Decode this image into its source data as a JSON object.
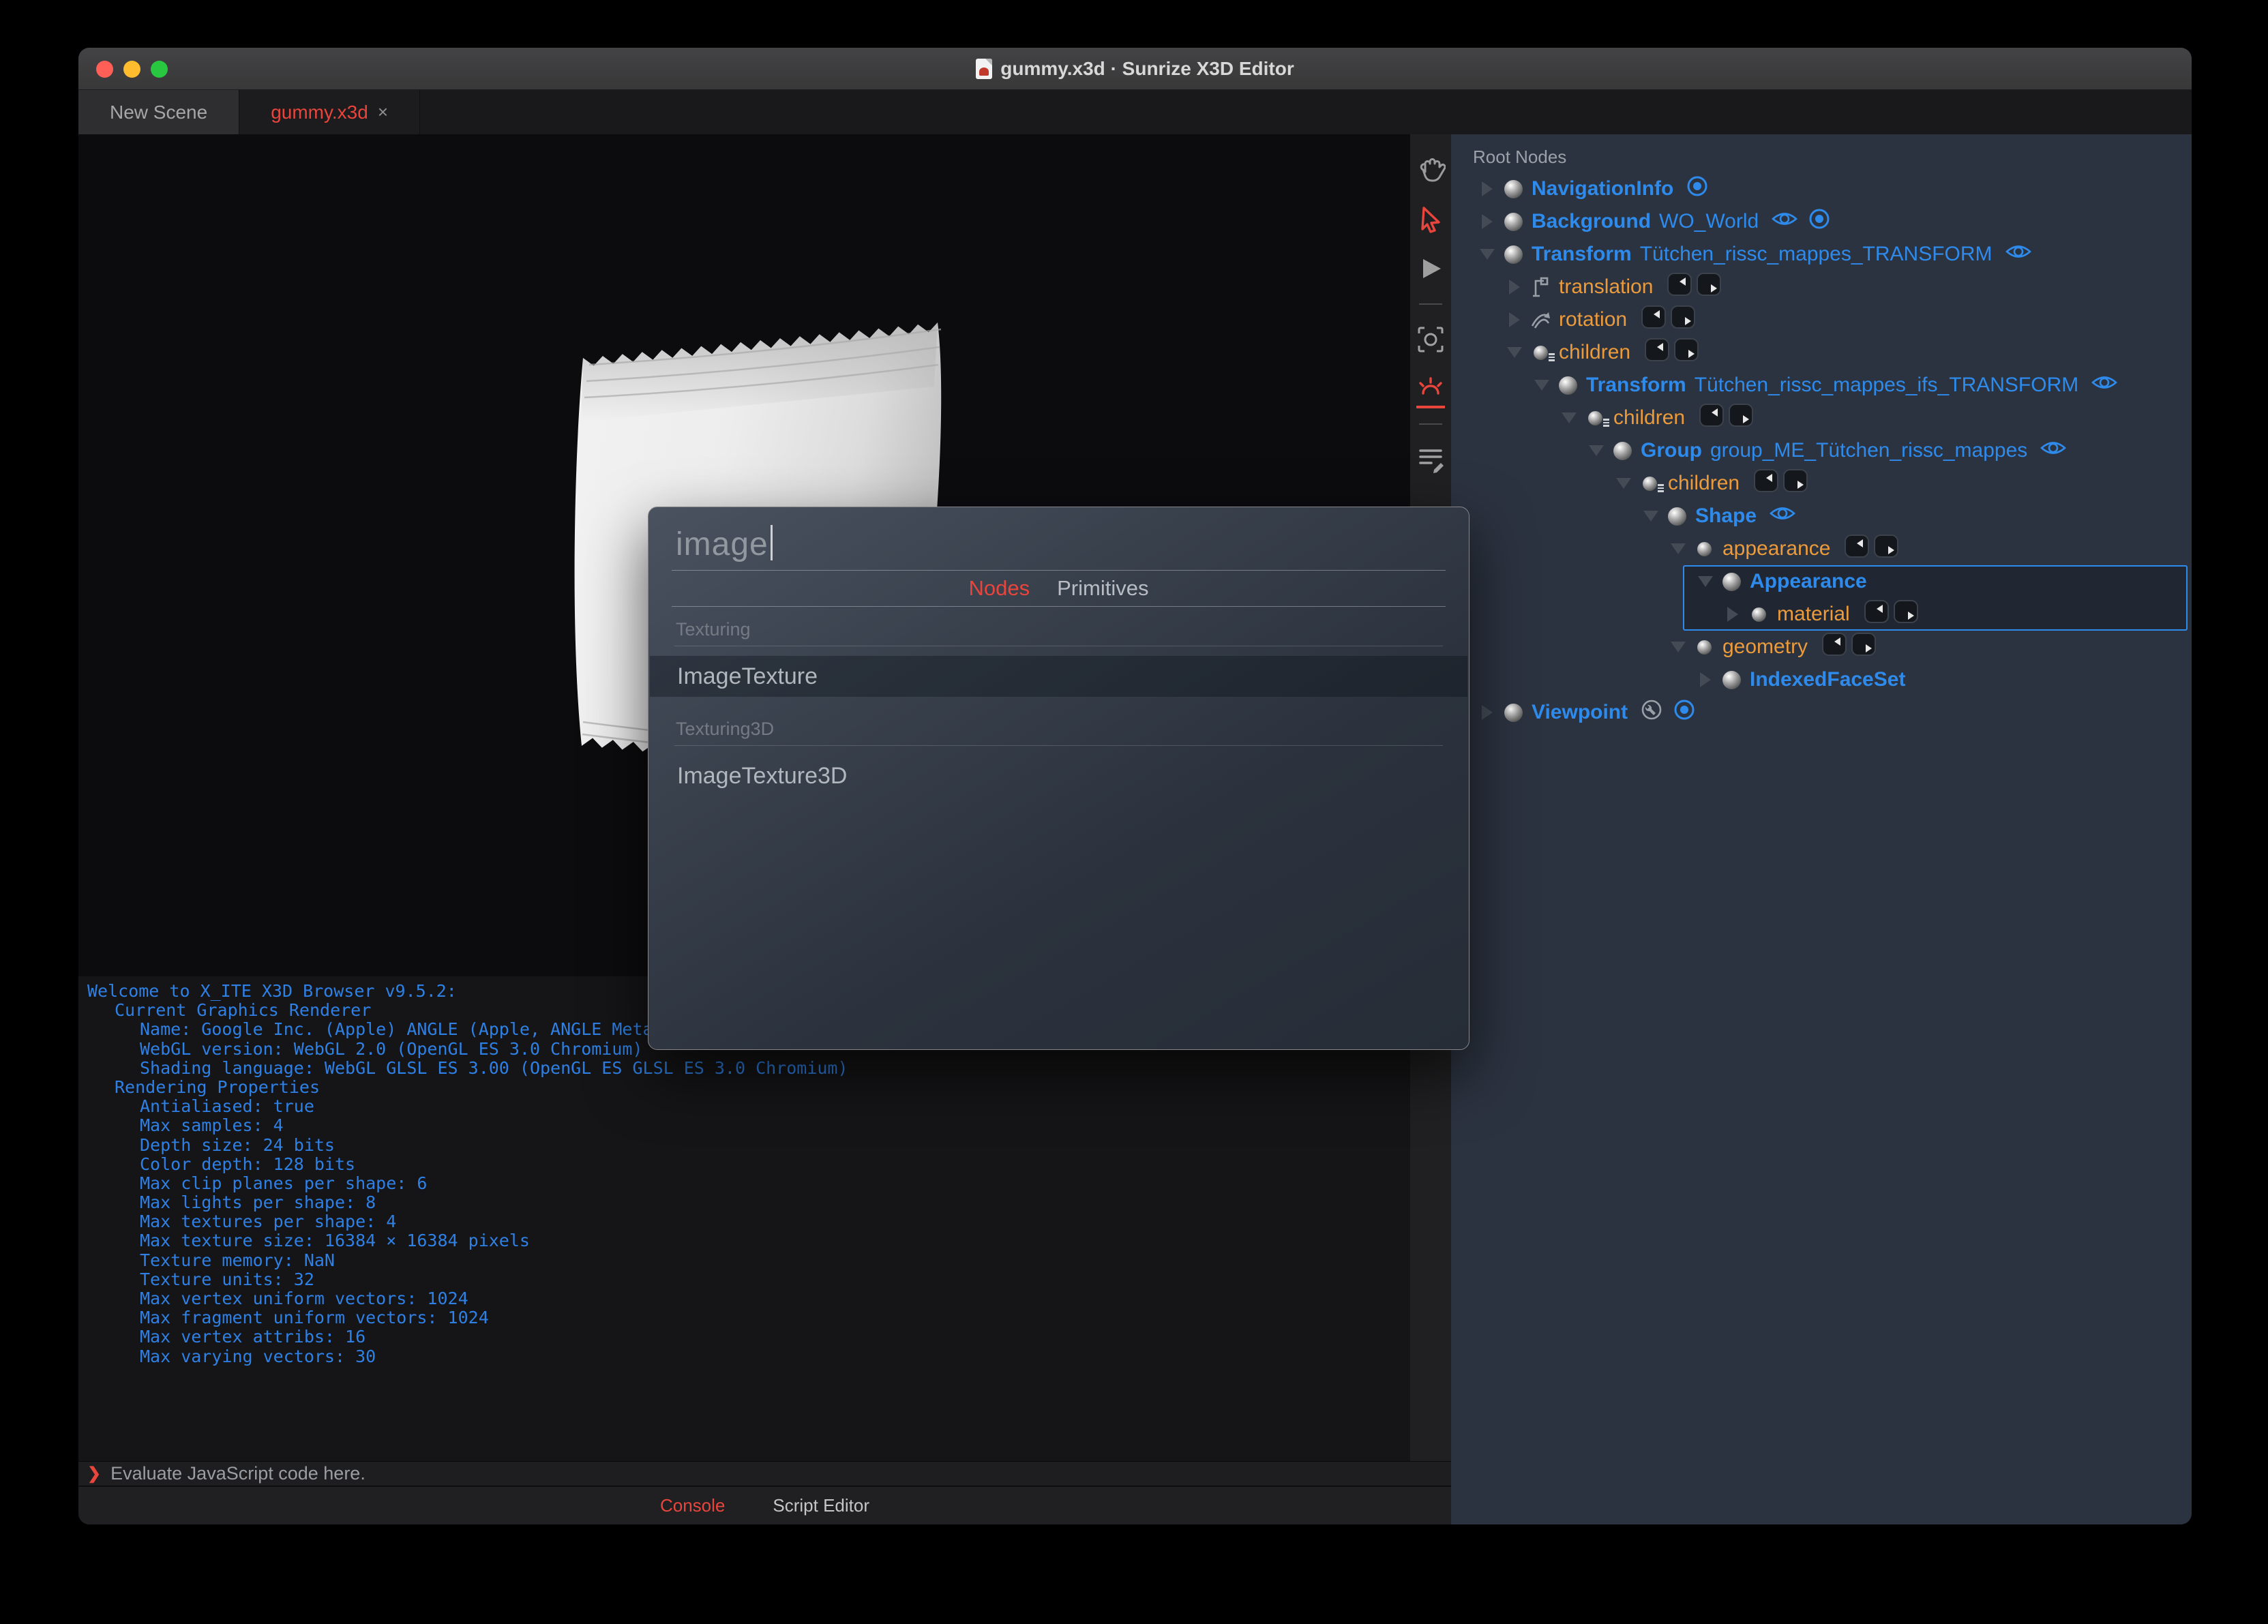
{
  "colors": {
    "red": "#e8453c",
    "blue": "#2e8bec",
    "orange": "#eb9b3c",
    "console_text": "#2f80e4",
    "panel_bg": "#2c3340"
  },
  "window": {
    "title": "gummy.x3d · Sunrize X3D Editor"
  },
  "editor_tabs": [
    {
      "label": "New Scene",
      "active": false
    },
    {
      "label": "gummy.x3d",
      "close": "×",
      "active": true
    }
  ],
  "toolbar": {
    "tools": [
      {
        "icon": "hand-icon",
        "active": false
      },
      {
        "icon": "pointer-icon",
        "active": true
      },
      {
        "icon": "play-icon",
        "active": false
      },
      {
        "icon": "divider"
      },
      {
        "icon": "snapshot-icon",
        "active": false
      },
      {
        "icon": "light-icon",
        "active": true
      },
      {
        "icon": "divider"
      },
      {
        "icon": "script-icon",
        "active": false
      }
    ]
  },
  "console": {
    "lines": [
      {
        "indent": 0,
        "text": "Welcome to X_ITE X3D Browser v9.5.2:"
      },
      {
        "indent": 1,
        "text": "Current Graphics Renderer"
      },
      {
        "indent": 2,
        "text": "Name: Google Inc. (Apple) ANGLE (Apple, ANGLE Metal Renderer: Apple"
      },
      {
        "indent": 2,
        "text": "WebGL version: WebGL 2.0 (OpenGL ES 3.0 Chromium)"
      },
      {
        "indent": 2,
        "text": "Shading language: WebGL GLSL ES 3.00 (OpenGL ES GLSL ES 3.0 Chromium)"
      },
      {
        "indent": 1,
        "text": "Rendering Properties"
      },
      {
        "indent": 2,
        "text": "Antialiased: true"
      },
      {
        "indent": 2,
        "text": "Max samples: 4"
      },
      {
        "indent": 2,
        "text": "Depth size: 24 bits"
      },
      {
        "indent": 2,
        "text": "Color depth: 128 bits"
      },
      {
        "indent": 2,
        "text": "Max clip planes per shape: 6"
      },
      {
        "indent": 2,
        "text": "Max lights per shape: 8"
      },
      {
        "indent": 2,
        "text": "Max textures per shape: 4"
      },
      {
        "indent": 2,
        "text": "Max texture size: 16384 × 16384 pixels"
      },
      {
        "indent": 2,
        "text": "Texture memory: NaN"
      },
      {
        "indent": 2,
        "text": "Texture units: 32"
      },
      {
        "indent": 2,
        "text": "Max vertex uniform vectors: 1024"
      },
      {
        "indent": 2,
        "text": "Max fragment uniform vectors: 1024"
      },
      {
        "indent": 2,
        "text": "Max vertex attribs: 16"
      },
      {
        "indent": 2,
        "text": "Max varying vectors: 30"
      }
    ],
    "prompt": {
      "symbol": "❯",
      "placeholder": "Evaluate JavaScript code here."
    },
    "tabs": [
      {
        "label": "Console",
        "active": true
      },
      {
        "label": "Script Editor",
        "active": false
      }
    ]
  },
  "outline": {
    "header": "Root Nodes",
    "rows": [
      {
        "level": 0,
        "arrow": "right",
        "icon": "ball",
        "name": "NavigationInfo",
        "def": "",
        "trail": [
          "bind-icon"
        ]
      },
      {
        "level": 0,
        "arrow": "right",
        "icon": "ball",
        "name": "Background",
        "def": "WO_World",
        "trail": [
          "eye-icon",
          "bind-icon"
        ]
      },
      {
        "level": 0,
        "arrow": "down",
        "icon": "ball",
        "name": "Transform",
        "def": "Tütchen_rissc_mappes_TRANSFORM",
        "trail": [
          "eye-icon"
        ]
      },
      {
        "level": 1,
        "arrow": "right",
        "icon": "translation",
        "field": "translation",
        "routes": true
      },
      {
        "level": 1,
        "arrow": "right",
        "icon": "rotation",
        "field": "rotation",
        "routes": true
      },
      {
        "level": 1,
        "arrow": "down",
        "icon": "ball-list",
        "field": "children",
        "routes": true
      },
      {
        "level": 2,
        "arrow": "down",
        "icon": "ball",
        "name": "Transform",
        "def": "Tütchen_rissc_mappes_ifs_TRANSFORM",
        "trail": [
          "eye-icon"
        ]
      },
      {
        "level": 3,
        "arrow": "down",
        "icon": "ball-list",
        "field": "children",
        "routes": true
      },
      {
        "level": 4,
        "arrow": "down",
        "icon": "ball",
        "name": "Group",
        "def": "group_ME_Tütchen_rissc_mappes",
        "trail": [
          "eye-icon"
        ]
      },
      {
        "level": 5,
        "arrow": "down",
        "icon": "ball-list",
        "field": "children",
        "routes": true
      },
      {
        "level": 6,
        "arrow": "down",
        "icon": "ball",
        "name": "Shape",
        "def": "",
        "trail": [
          "eye-icon"
        ]
      },
      {
        "level": 7,
        "arrow": "down",
        "icon": "ball-sm",
        "field": "appearance",
        "routes": true
      },
      {
        "level": 8,
        "arrow": "down",
        "icon": "ball",
        "name": "Appearance",
        "def": "",
        "trail": [],
        "selected": true
      },
      {
        "level": 9,
        "arrow": "right",
        "icon": "ball-sm",
        "field": "material",
        "routes": true,
        "selected": true
      },
      {
        "level": 7,
        "arrow": "down",
        "icon": "ball-sm",
        "field": "geometry",
        "routes": true
      },
      {
        "level": 8,
        "arrow": "right",
        "icon": "ball",
        "name": "IndexedFaceSet",
        "def": "",
        "trail": []
      },
      {
        "level": 0,
        "arrow": "right",
        "icon": "ball",
        "name": "Viewpoint",
        "def": "",
        "trail": [
          "wrench-icon",
          "bind-icon"
        ]
      }
    ]
  },
  "dialog": {
    "query": "image",
    "tabs": [
      {
        "label": "Nodes",
        "active": true
      },
      {
        "label": "Primitives",
        "active": false
      }
    ],
    "sections": [
      {
        "title": "Texturing",
        "items": [
          {
            "label": "ImageTexture",
            "selected": true
          }
        ]
      },
      {
        "title": "Texturing3D",
        "items": [
          {
            "label": "ImageTexture3D",
            "selected": false
          }
        ]
      }
    ]
  }
}
